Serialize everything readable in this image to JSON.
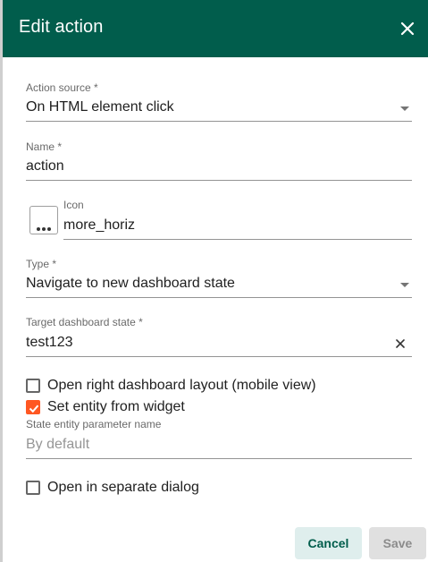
{
  "dialog": {
    "title": "Edit action",
    "close_icon": "close-icon"
  },
  "fields": {
    "action_source": {
      "label": "Action source *",
      "value": "On HTML element click"
    },
    "name": {
      "label": "Name *",
      "value": "action"
    },
    "icon": {
      "label": "Icon",
      "value": "more_horiz",
      "button_icon": "more-horiz-icon"
    },
    "type": {
      "label": "Type *",
      "value": "Navigate to new dashboard state"
    },
    "target_state": {
      "label": "Target dashboard state *",
      "value": "test123",
      "clear_icon": "clear-icon"
    },
    "state_entity_param": {
      "label": "State entity parameter name",
      "placeholder": "By default"
    }
  },
  "checkboxes": {
    "open_right_layout": {
      "label": "Open right dashboard layout (mobile view)",
      "checked": false
    },
    "set_entity": {
      "label": "Set entity from widget",
      "checked": true
    },
    "separate_dialog": {
      "label": "Open in separate dialog",
      "checked": false
    }
  },
  "actions": {
    "cancel": "Cancel",
    "save": "Save"
  },
  "colors": {
    "header": "#015d4c",
    "accent": "#ff5722",
    "cancel_bg": "#dfeeed"
  }
}
